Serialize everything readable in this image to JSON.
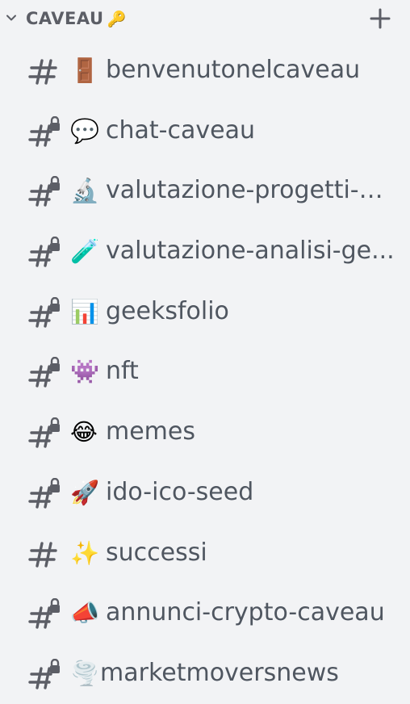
{
  "category": {
    "title": "CAVEAU",
    "emoji": "🔑",
    "icons": {
      "collapse": "chevron-down-icon",
      "add": "plus-icon"
    }
  },
  "channels": [
    {
      "name": "benvenutonelcaveau",
      "emoji": "🚪",
      "icon": "hash-icon"
    },
    {
      "name": "chat-caveau",
      "emoji": "💬",
      "icon": "hash-lock-icon"
    },
    {
      "name": "valutazione-progetti-g...",
      "emoji": "🔬",
      "icon": "hash-lock-icon"
    },
    {
      "name": "valutazione-analisi-ge...",
      "emoji": "🧪",
      "icon": "hash-lock-icon"
    },
    {
      "name": "geeksfolio",
      "emoji": "📊",
      "icon": "hash-lock-icon"
    },
    {
      "name": "nft",
      "emoji": "👾",
      "icon": "hash-lock-icon"
    },
    {
      "name": "memes",
      "emoji": "😂",
      "icon": "hash-lock-icon"
    },
    {
      "name": "ido-ico-seed",
      "emoji": "🚀",
      "icon": "hash-lock-icon"
    },
    {
      "name": "successi",
      "emoji": "✨",
      "icon": "hash-icon"
    },
    {
      "name": "annunci-crypto-caveau",
      "emoji": "📣",
      "icon": "hash-lock-icon"
    },
    {
      "name": "marketmoversnews",
      "emoji": "🌪️",
      "icon": "hash-lock-icon"
    }
  ],
  "colors": {
    "background": "#f2f3f5",
    "icon": "#5c5e66",
    "text": "#4f5660"
  }
}
